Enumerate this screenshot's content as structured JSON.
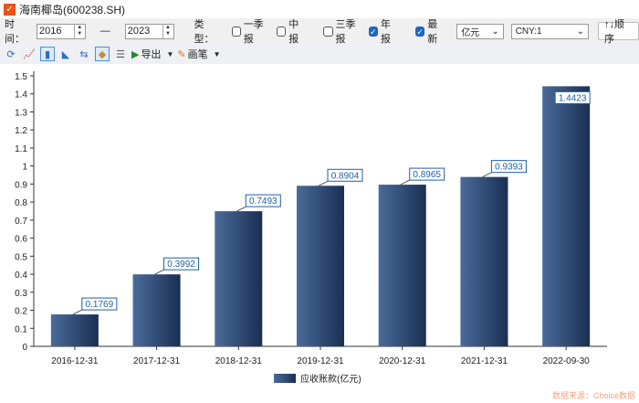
{
  "window": {
    "title": "海南椰岛(600238.SH)",
    "logo": "✓"
  },
  "filters": {
    "time_label": "时间：",
    "start_year": "2016",
    "dash": "—",
    "end_year": "2023",
    "type_label": "类型：",
    "checks": [
      {
        "label": "一季报",
        "checked": false
      },
      {
        "label": "中报",
        "checked": false
      },
      {
        "label": "三季报",
        "checked": false
      },
      {
        "label": "年报",
        "checked": true
      },
      {
        "label": "最新",
        "checked": true
      }
    ],
    "unit": "亿元",
    "currency": "CNY:1",
    "sort_label": "↑↓顺序"
  },
  "toolbar": {
    "export_label": "导出",
    "pen_label": "画笔"
  },
  "chart_data": {
    "type": "bar",
    "categories": [
      "2016-12-31",
      "2017-12-31",
      "2018-12-31",
      "2019-12-31",
      "2020-12-31",
      "2021-12-31",
      "2022-09-30"
    ],
    "series": [
      {
        "name": "应收账款(亿元)",
        "values": [
          0.1769,
          0.3992,
          0.7493,
          0.8904,
          0.8965,
          0.9393,
          1.4423
        ]
      }
    ],
    "ylim": [
      0,
      1.5
    ],
    "yticks": [
      "0",
      "0.1",
      "0.2",
      "0.3",
      "0.4",
      "0.5",
      "0.6",
      "0.7",
      "0.8",
      "0.9",
      "1",
      "1.1",
      "1.2",
      "1.3",
      "1.4",
      "1.5"
    ],
    "legend": "bottom",
    "colors": {
      "bar_light": "#4a6b9a",
      "bar_dark": "#1a2f52",
      "label": "#1f5fa8"
    }
  },
  "watermark": "数据来源：Choice数据"
}
